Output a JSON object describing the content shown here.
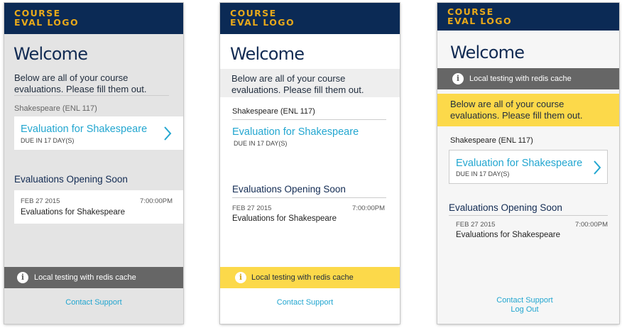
{
  "logo": {
    "line1": "COURSE",
    "line2": "EVAL LOGO"
  },
  "welcome": "Welcome",
  "intro": "Below are all of your course evaluations. Please fill them out.",
  "course": {
    "name": "Shakespeare (ENL 117)",
    "evaluation_link": "Evaluation for Shakespeare",
    "due": "DUE IN 17 DAY(S)"
  },
  "opening_soon": {
    "title": "Evaluations Opening Soon",
    "items": [
      {
        "date": "FEB 27 2015",
        "time": "7:00:00PM",
        "name": "Evaluations for Shakespeare"
      }
    ]
  },
  "banner": {
    "icon": "info-icon",
    "glyph": "i",
    "text": "Local testing with redis cache"
  },
  "footer": {
    "contact": "Contact Support",
    "logout": "Log Out"
  },
  "colors": {
    "navy": "#0b2a55",
    "gold": "#e8a91a",
    "link": "#22a6d0",
    "banner_gray": "#666666",
    "banner_yellow": "#fcd94a"
  }
}
